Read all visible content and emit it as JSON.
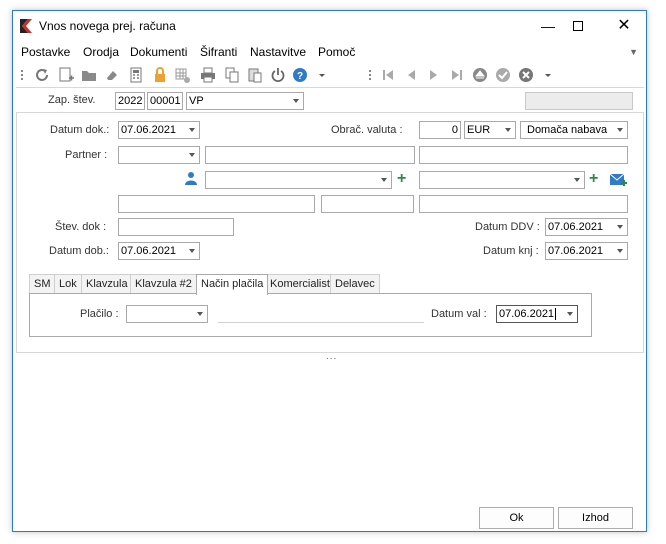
{
  "window": {
    "title": "Vnos novega prej. računa"
  },
  "menu": [
    "Postavke",
    "Orodja",
    "Dokumenti",
    "Šifranti",
    "Nastavitve",
    "Pomoč"
  ],
  "zap": {
    "label": "Zap. štev.",
    "year": "2022",
    "number": "00001",
    "type": "VP"
  },
  "form": {
    "datum_dok_label": "Datum dok.:",
    "datum_dok": "07.06.2021",
    "obrac_valuta_label": "Obrač. valuta :",
    "valuta_amount": "0",
    "valuta": "EUR",
    "nabava": "Domača nabava",
    "partner_label": "Partner :",
    "stev_dok_label": "Štev. dok :",
    "datum_ddv_label": "Datum DDV :",
    "datum_ddv": "07.06.2021",
    "datum_dob_label": "Datum dob.:",
    "datum_dob": "07.06.2021",
    "datum_knj_label": "Datum knj :",
    "datum_knj": "07.06.2021"
  },
  "tabs": [
    "SM",
    "Lok",
    "Klavzula",
    "Klavzula #2",
    "Način plačila",
    "Komercialist",
    "Delavec"
  ],
  "active_tab": "Način plačila",
  "placilo": {
    "label": "Plačilo :",
    "datum_val_label": "Datum val :",
    "datum_val": "07.06.2021"
  },
  "splitter": "...",
  "buttons": {
    "ok": "Ok",
    "izhod": "Izhod"
  },
  "colors": {
    "accent": "#2b79d7",
    "add": "#2e8b3e",
    "person": "#2f7bc8"
  }
}
